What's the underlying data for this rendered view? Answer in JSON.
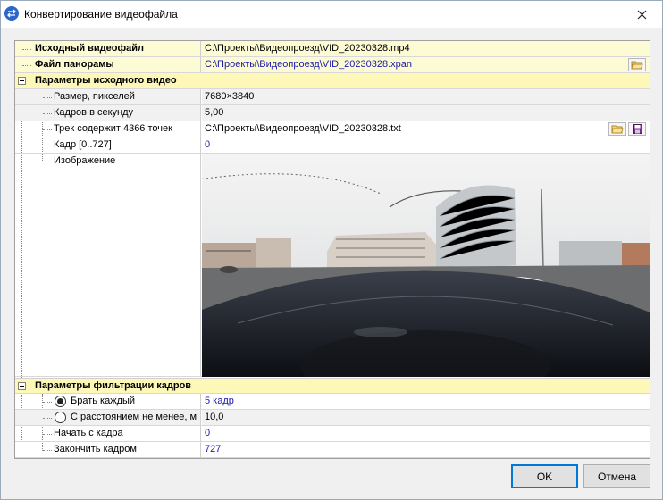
{
  "window": {
    "title": "Конвертирование видеофайла",
    "app_icon": "video-convert-icon",
    "close_icon": "close-icon"
  },
  "properties": {
    "source_file": {
      "label": "Исходный видеофайл",
      "value": "C:\\Проекты\\Видеопроезд\\VID_20230328.mp4"
    },
    "panorama_file": {
      "label": "Файл панорамы",
      "value": "C:\\Проекты\\Видеопроезд\\VID_20230328.xpan"
    },
    "source_params": {
      "label": "Параметры исходного видео",
      "size": {
        "label": "Размер, пикселей",
        "value": "7680×3840"
      },
      "fps": {
        "label": "Кадров в секунду",
        "value": "5,00"
      },
      "track": {
        "label": "Трек содержит 4366 точек",
        "value": "C:\\Проекты\\Видеопроезд\\VID_20230328.txt"
      },
      "frame": {
        "label": "Кадр [0..727]",
        "value": "0"
      },
      "image": {
        "label": "Изображение"
      }
    },
    "filter_params": {
      "label": "Параметры фильтрации кадров",
      "every": {
        "label": "Брать каждый",
        "value": "5 кадр",
        "selected": true
      },
      "distance": {
        "label": "С расстоянием не менее, м",
        "value": "10,0",
        "selected": false
      },
      "start": {
        "label": "Начать с кадра",
        "value": "0"
      },
      "end": {
        "label": "Закончить кадром",
        "value": "727"
      }
    }
  },
  "buttons": {
    "ok": "OK",
    "cancel": "Отмена"
  },
  "icons": {
    "folder": "folder-open-icon",
    "save": "save-icon"
  },
  "colors": {
    "category_bg": "#fdf8b8",
    "link": "#1a1aa6",
    "accent": "#0078d7"
  }
}
